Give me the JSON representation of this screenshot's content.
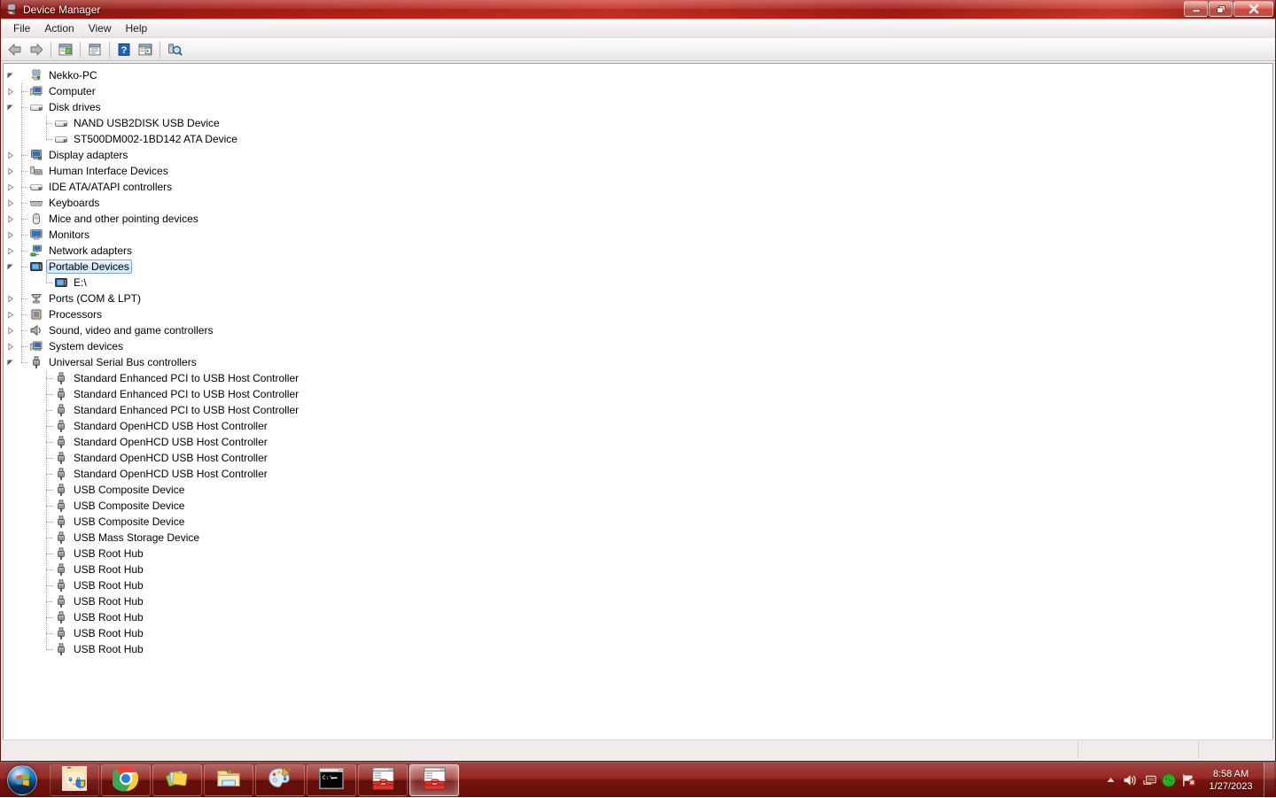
{
  "window": {
    "title": "Device Manager",
    "title_icon": "computer-icon",
    "controls": {
      "minimize": "Minimize",
      "restore": "Restore",
      "close": "Close"
    }
  },
  "menubar": {
    "items": [
      {
        "label": "File",
        "name": "menu-file"
      },
      {
        "label": "Action",
        "name": "menu-action"
      },
      {
        "label": "View",
        "name": "menu-view"
      },
      {
        "label": "Help",
        "name": "menu-help"
      }
    ]
  },
  "toolbar": {
    "buttons": [
      {
        "name": "back-button",
        "icon": "back-arrow-icon",
        "tooltip": "Back"
      },
      {
        "name": "forward-button",
        "icon": "forward-arrow-icon",
        "tooltip": "Forward"
      },
      {
        "name": "show-console-tree-button",
        "icon": "console-tree-icon",
        "tooltip": "Show/Hide Console Tree"
      },
      {
        "name": "properties-button",
        "icon": "properties-icon",
        "tooltip": "Properties"
      },
      {
        "name": "help-button",
        "icon": "help-question-icon",
        "tooltip": "Help"
      },
      {
        "name": "show-hidden-devices-button",
        "icon": "show-hidden-icon",
        "tooltip": "Show hidden devices"
      },
      {
        "name": "scan-hardware-changes-button",
        "icon": "scan-hardware-icon",
        "tooltip": "Scan for hardware changes"
      }
    ]
  },
  "tree": {
    "root": {
      "label": "Nekko-PC",
      "icon": "computer-icon",
      "expanded": true
    },
    "nodes": [
      {
        "label": "Computer",
        "icon": "computer-small-icon",
        "level": 1,
        "expandable": true,
        "expanded": false,
        "last": false
      },
      {
        "label": "Disk drives",
        "icon": "disk-drive-icon",
        "level": 1,
        "expandable": true,
        "expanded": true,
        "last": false
      },
      {
        "label": "NAND USB2DISK USB Device",
        "icon": "disk-drive-icon",
        "level": 2,
        "expandable": false,
        "expanded": false,
        "last": false
      },
      {
        "label": "ST500DM002-1BD142 ATA Device",
        "icon": "disk-drive-icon",
        "level": 2,
        "expandable": false,
        "expanded": false,
        "last": true
      },
      {
        "label": "Display adapters",
        "icon": "display-adapter-icon",
        "level": 1,
        "expandable": true,
        "expanded": false,
        "last": false
      },
      {
        "label": "Human Interface Devices",
        "icon": "hid-icon",
        "level": 1,
        "expandable": true,
        "expanded": false,
        "last": false
      },
      {
        "label": "IDE ATA/ATAPI controllers",
        "icon": "ide-controller-icon",
        "level": 1,
        "expandable": true,
        "expanded": false,
        "last": false
      },
      {
        "label": "Keyboards",
        "icon": "keyboard-icon",
        "level": 1,
        "expandable": true,
        "expanded": false,
        "last": false
      },
      {
        "label": "Mice and other pointing devices",
        "icon": "mouse-icon",
        "level": 1,
        "expandable": true,
        "expanded": false,
        "last": false
      },
      {
        "label": "Monitors",
        "icon": "monitor-icon",
        "level": 1,
        "expandable": true,
        "expanded": false,
        "last": false
      },
      {
        "label": "Network adapters",
        "icon": "network-adapter-icon",
        "level": 1,
        "expandable": true,
        "expanded": false,
        "last": false
      },
      {
        "label": "Portable Devices",
        "icon": "portable-device-icon",
        "level": 1,
        "expandable": true,
        "expanded": true,
        "last": false,
        "selected": true
      },
      {
        "label": "E:\\",
        "icon": "portable-device-icon",
        "level": 2,
        "expandable": false,
        "expanded": false,
        "last": true
      },
      {
        "label": "Ports (COM & LPT)",
        "icon": "port-icon",
        "level": 1,
        "expandable": true,
        "expanded": false,
        "last": false
      },
      {
        "label": "Processors",
        "icon": "processor-icon",
        "level": 1,
        "expandable": true,
        "expanded": false,
        "last": false
      },
      {
        "label": "Sound, video and game controllers",
        "icon": "sound-icon",
        "level": 1,
        "expandable": true,
        "expanded": false,
        "last": false
      },
      {
        "label": "System devices",
        "icon": "computer-small-icon",
        "level": 1,
        "expandable": true,
        "expanded": false,
        "last": false
      },
      {
        "label": "Universal Serial Bus controllers",
        "icon": "usb-icon",
        "level": 1,
        "expandable": true,
        "expanded": true,
        "last": true
      },
      {
        "label": "Standard Enhanced PCI to USB Host Controller",
        "icon": "usb-icon",
        "level": 2,
        "expandable": false,
        "expanded": false,
        "last": false
      },
      {
        "label": "Standard Enhanced PCI to USB Host Controller",
        "icon": "usb-icon",
        "level": 2,
        "expandable": false,
        "expanded": false,
        "last": false
      },
      {
        "label": "Standard Enhanced PCI to USB Host Controller",
        "icon": "usb-icon",
        "level": 2,
        "expandable": false,
        "expanded": false,
        "last": false
      },
      {
        "label": "Standard OpenHCD USB Host Controller",
        "icon": "usb-icon",
        "level": 2,
        "expandable": false,
        "expanded": false,
        "last": false
      },
      {
        "label": "Standard OpenHCD USB Host Controller",
        "icon": "usb-icon",
        "level": 2,
        "expandable": false,
        "expanded": false,
        "last": false
      },
      {
        "label": "Standard OpenHCD USB Host Controller",
        "icon": "usb-icon",
        "level": 2,
        "expandable": false,
        "expanded": false,
        "last": false
      },
      {
        "label": "Standard OpenHCD USB Host Controller",
        "icon": "usb-icon",
        "level": 2,
        "expandable": false,
        "expanded": false,
        "last": false
      },
      {
        "label": "USB Composite Device",
        "icon": "usb-icon",
        "level": 2,
        "expandable": false,
        "expanded": false,
        "last": false
      },
      {
        "label": "USB Composite Device",
        "icon": "usb-icon",
        "level": 2,
        "expandable": false,
        "expanded": false,
        "last": false
      },
      {
        "label": "USB Composite Device",
        "icon": "usb-icon",
        "level": 2,
        "expandable": false,
        "expanded": false,
        "last": false
      },
      {
        "label": "USB Mass Storage Device",
        "icon": "usb-icon",
        "level": 2,
        "expandable": false,
        "expanded": false,
        "last": false
      },
      {
        "label": "USB Root Hub",
        "icon": "usb-icon",
        "level": 2,
        "expandable": false,
        "expanded": false,
        "last": false
      },
      {
        "label": "USB Root Hub",
        "icon": "usb-icon",
        "level": 2,
        "expandable": false,
        "expanded": false,
        "last": false
      },
      {
        "label": "USB Root Hub",
        "icon": "usb-icon",
        "level": 2,
        "expandable": false,
        "expanded": false,
        "last": false
      },
      {
        "label": "USB Root Hub",
        "icon": "usb-icon",
        "level": 2,
        "expandable": false,
        "expanded": false,
        "last": false
      },
      {
        "label": "USB Root Hub",
        "icon": "usb-icon",
        "level": 2,
        "expandable": false,
        "expanded": false,
        "last": false
      },
      {
        "label": "USB Root Hub",
        "icon": "usb-icon",
        "level": 2,
        "expandable": false,
        "expanded": false,
        "last": false
      },
      {
        "label": "USB Root Hub",
        "icon": "usb-icon",
        "level": 2,
        "expandable": false,
        "expanded": false,
        "last": true
      }
    ]
  },
  "statusbar": {
    "panes": [
      "",
      "",
      ""
    ]
  },
  "taskbar": {
    "start": {
      "name": "start-button",
      "icon": "windows-orb-icon"
    },
    "buttons": [
      {
        "name": "taskbar-item-avatar-app",
        "icon": "anime-avatar-shield-icon",
        "active": false,
        "pinned_plain": true
      },
      {
        "name": "taskbar-item-chrome",
        "icon": "chrome-icon",
        "active": false
      },
      {
        "name": "taskbar-item-photo-viewer",
        "icon": "photos-icon",
        "active": false
      },
      {
        "name": "taskbar-item-explorer",
        "icon": "explorer-folder-icon",
        "active": false
      },
      {
        "name": "taskbar-item-paint",
        "icon": "paint-palette-icon",
        "active": false
      },
      {
        "name": "taskbar-item-command-prompt",
        "icon": "command-prompt-icon",
        "active": false
      },
      {
        "name": "taskbar-item-device-manager-1",
        "icon": "device-manager-toolbox-icon",
        "active": false
      },
      {
        "name": "taskbar-item-device-manager-2",
        "icon": "device-manager-toolbox-icon",
        "active": true
      }
    ],
    "tray": [
      {
        "name": "tray-show-hidden-icons",
        "icon": "chevron-up-icon"
      },
      {
        "name": "tray-volume",
        "icon": "speaker-icon"
      },
      {
        "name": "tray-network",
        "icon": "network-monitor-icon"
      },
      {
        "name": "tray-antivirus",
        "icon": "green-globe-icon"
      },
      {
        "name": "tray-action-center",
        "icon": "flag-error-icon"
      }
    ],
    "clock": {
      "time": "8:58 AM",
      "date": "1/27/2023"
    },
    "show_desktop": {
      "name": "show-desktop-button"
    }
  },
  "colors": {
    "accent": "#a81c17",
    "titlebar_start": "#8d1611",
    "titlebar_end": "#8c1510",
    "selection_border": "#7da2ce",
    "content_bg": "#ffffff"
  }
}
